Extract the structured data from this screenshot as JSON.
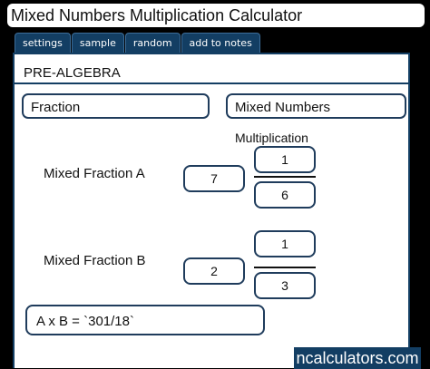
{
  "title": "Mixed Numbers Multiplication Calculator",
  "tabs": [
    {
      "label": "settings"
    },
    {
      "label": "sample"
    },
    {
      "label": "random"
    },
    {
      "label": "add to notes"
    }
  ],
  "topic": "PRE-ALGEBRA",
  "breadcrumbs": {
    "fraction": "Fraction",
    "mixed_numbers": "Mixed Numbers",
    "multiplication": "Multiplication"
  },
  "fraction_a": {
    "label": "Mixed Fraction A",
    "whole": "7",
    "numerator": "1",
    "denominator": "6"
  },
  "fraction_b": {
    "label": "Mixed Fraction B",
    "whole": "2",
    "numerator": "1",
    "denominator": "3"
  },
  "result": "A x B  =  `301/18`",
  "brand": "ncalculators.com",
  "colors": {
    "primary": "#133e63",
    "background": "#000000",
    "panel": "#ffffff"
  }
}
